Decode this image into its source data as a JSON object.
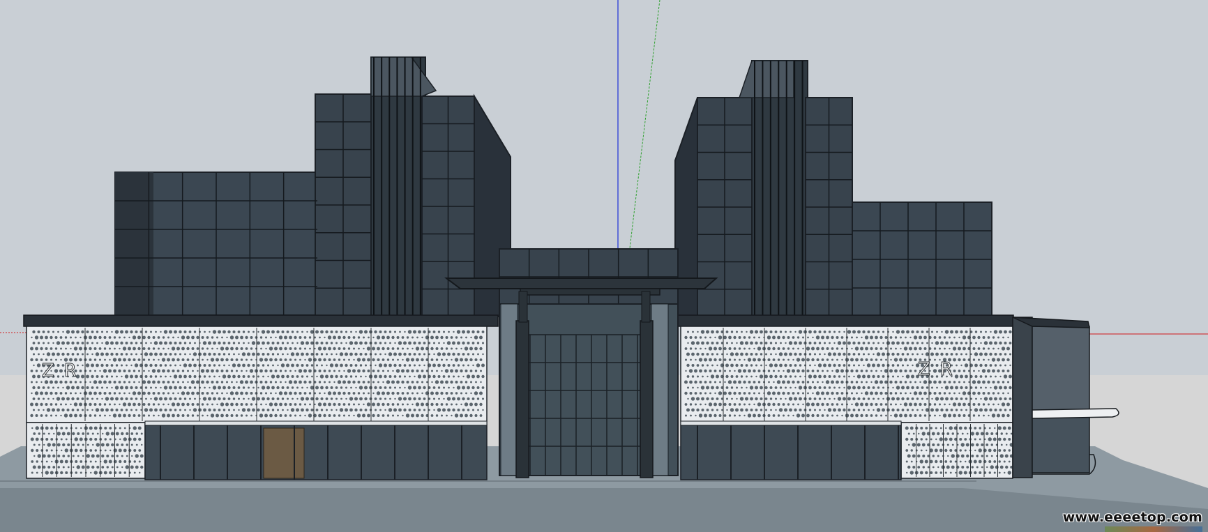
{
  "viewport": {
    "sky_color": "#c9cfd5",
    "ground_color": "#d6d6d6",
    "axis_colors": {
      "blue": "#1a2fd6",
      "green": "#2ca02c",
      "red": "#d11a1a"
    }
  },
  "model": {
    "tower_glass_color": "#3b4752",
    "frame_color": "#232a30",
    "podium_panel_color": "#e9ecef",
    "plaza_color": "#8e9aa2",
    "facade_letters": {
      "left_panel": "ZR",
      "right_panel": "ZR"
    }
  },
  "watermark": {
    "text": "www.eeeetop.com"
  }
}
